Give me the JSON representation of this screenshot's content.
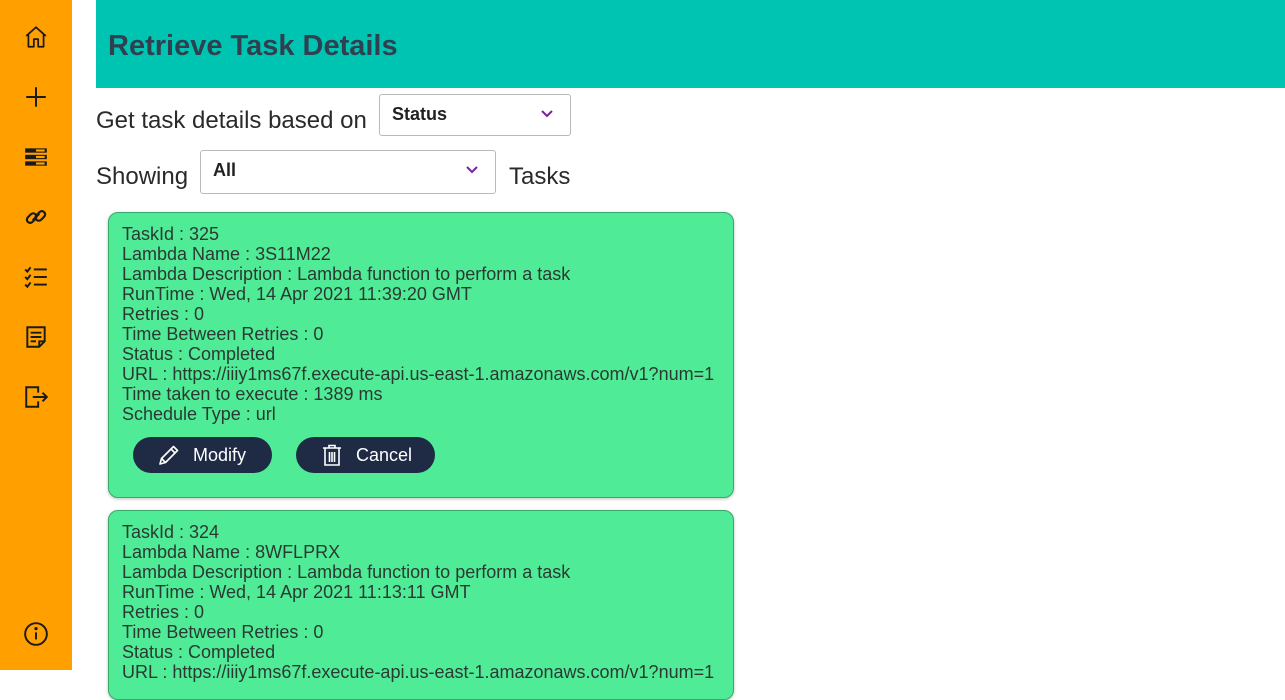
{
  "sidebar": {
    "items": [
      {
        "icon": "home-icon"
      },
      {
        "icon": "plus-icon"
      },
      {
        "icon": "list-icon"
      },
      {
        "icon": "link-icon"
      },
      {
        "icon": "checklist-icon"
      },
      {
        "icon": "document-icon"
      },
      {
        "icon": "logout-icon"
      },
      {
        "icon": "info-icon"
      }
    ],
    "background": "#ff9f00"
  },
  "header": {
    "title": "Retrieve Task Details",
    "background": "#00c4b2"
  },
  "filters": {
    "criteria_label": "Get task details based on",
    "criteria_value": "Status",
    "showing_label": "Showing",
    "showing_value": "All",
    "tasks_label": "Tasks"
  },
  "tasks": [
    {
      "lines": [
        "TaskId : 325",
        "Lambda Name : 3S11M22",
        "Lambda Description : Lambda function to perform a task",
        "RunTime : Wed, 14 Apr 2021 11:39:20 GMT",
        "Retries : 0",
        "Time Between Retries : 0",
        "Status : Completed",
        "URL : https://iiiy1ms67f.execute-api.us-east-1.amazonaws.com/v1?num=1",
        "Time taken to execute : 1389 ms",
        "Schedule Type : url"
      ],
      "modify_label": "Modify",
      "cancel_label": "Cancel"
    },
    {
      "lines": [
        "TaskId : 324",
        "Lambda Name : 8WFLPRX",
        "Lambda Description : Lambda function to perform a task",
        "RunTime : Wed, 14 Apr 2021 11:13:11 GMT",
        "Retries : 0",
        "Time Between Retries : 0",
        "Status : Completed",
        "URL : https://iiiy1ms67f.execute-api.us-east-1.amazonaws.com/v1?num=1"
      ]
    }
  ],
  "colors": {
    "card": "#50eb96",
    "button": "#1f2a44",
    "chevron": "#7b1fa2"
  }
}
